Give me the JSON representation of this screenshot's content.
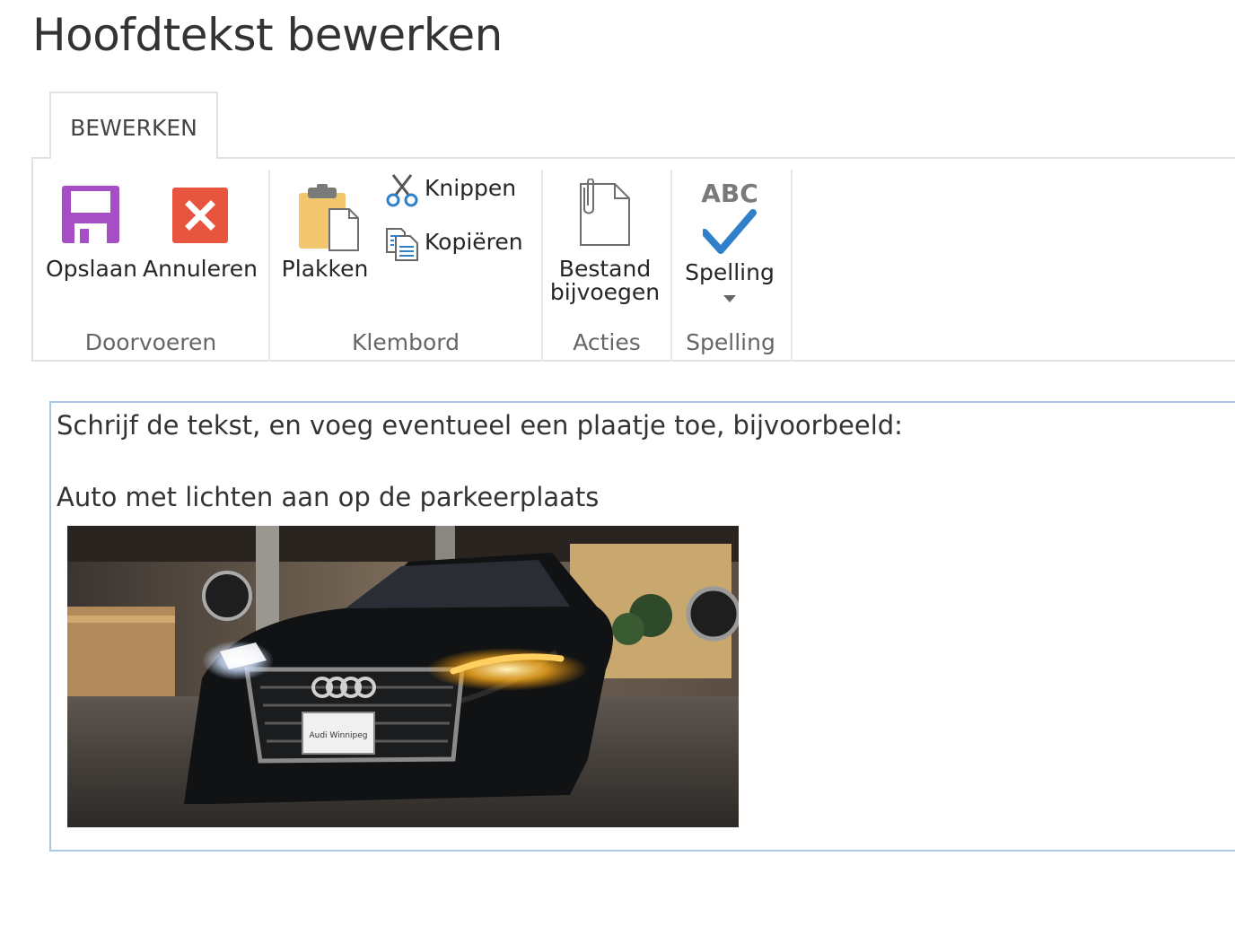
{
  "page": {
    "title": "Hoofdtekst bewerken"
  },
  "ribbon": {
    "tab_label": "BEWERKEN",
    "groups": {
      "doorvoeren": {
        "label": "Doorvoeren",
        "save_label": "Opslaan",
        "cancel_label": "Annuleren"
      },
      "klembord": {
        "label": "Klembord",
        "paste_label": "Plakken",
        "cut_label": "Knippen",
        "copy_label": "Kopiëren"
      },
      "acties": {
        "label": "Acties",
        "attach_label_line1": "Bestand",
        "attach_label_line2": "bijvoegen"
      },
      "spelling": {
        "label": "Spelling",
        "spelling_label": "Spelling",
        "abc_text": "ABC"
      }
    },
    "icons": {
      "save": "floppy-disk-icon",
      "cancel": "cancel-x-icon",
      "paste": "clipboard-icon",
      "cut": "scissors-icon",
      "copy": "copy-icon",
      "attach": "paperclip-file-icon",
      "spelling": "abc-check-icon",
      "dropdown": "chevron-down-icon"
    },
    "colors": {
      "save": "#a64fc4",
      "cancel": "#e8553f",
      "paste": "#f2c66d",
      "check": "#2f7fc9"
    }
  },
  "editor": {
    "line1": "Schrijf de tekst, en voeg eventueel een plaatje toe, bijvoorbeeld:",
    "line2": "Auto met lichten aan op de parkeerplaats",
    "image_caption": "Audi Winnipeg"
  }
}
